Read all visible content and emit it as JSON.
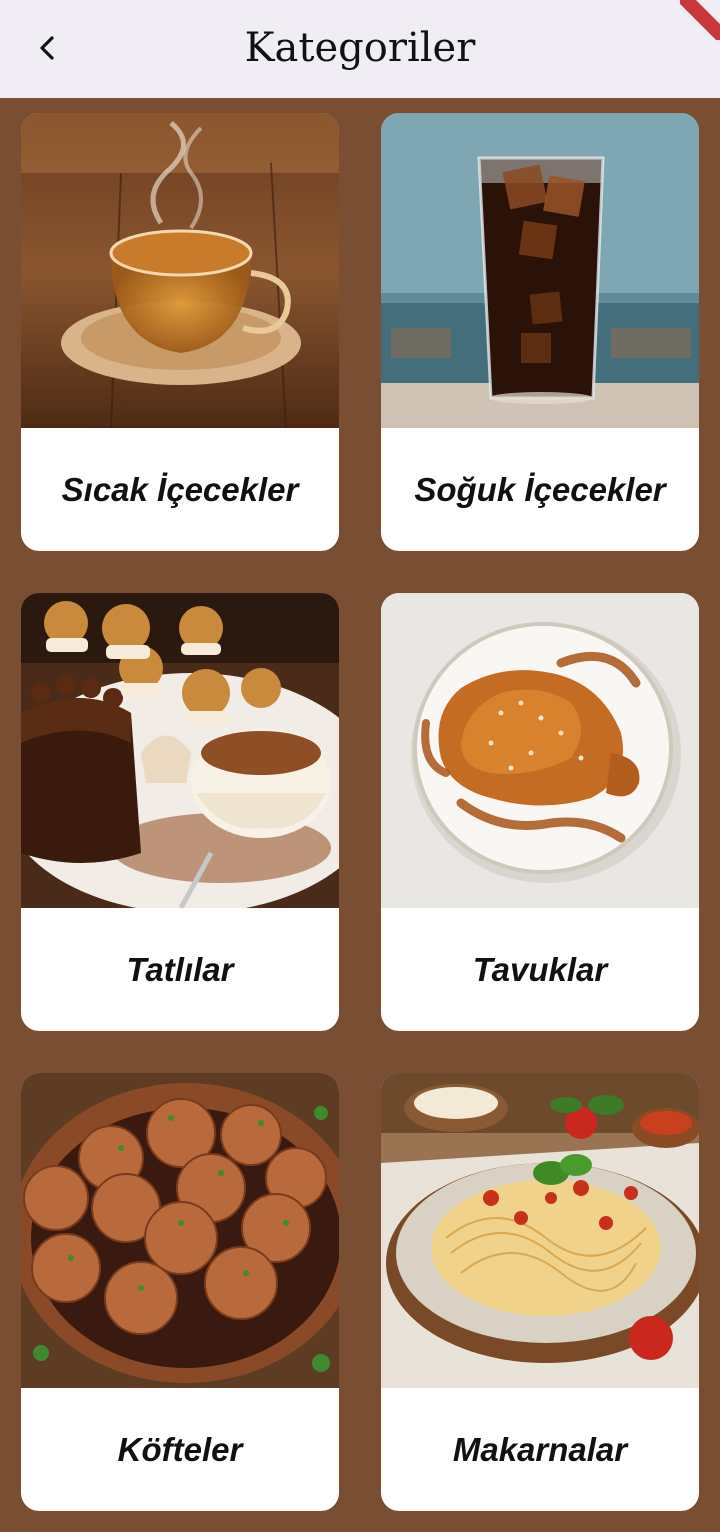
{
  "app_bar": {
    "title": "Kategoriler",
    "back_icon": "chevron-left-icon"
  },
  "categories": [
    {
      "label": "Sıcak İçecekler",
      "image": "hot-tea-cup-image"
    },
    {
      "label": "Soğuk İçecekler",
      "image": "iced-cola-glass-image"
    },
    {
      "label": "Tatlılar",
      "image": "desserts-plate-image"
    },
    {
      "label": "Tavuklar",
      "image": "glazed-chicken-image"
    },
    {
      "label": "Köfteler",
      "image": "meatballs-image"
    },
    {
      "label": "Makarnalar",
      "image": "spaghetti-image"
    }
  ],
  "colors": {
    "background": "#7a4e33",
    "app_bar": "#f0edf5",
    "card": "#ffffff"
  }
}
